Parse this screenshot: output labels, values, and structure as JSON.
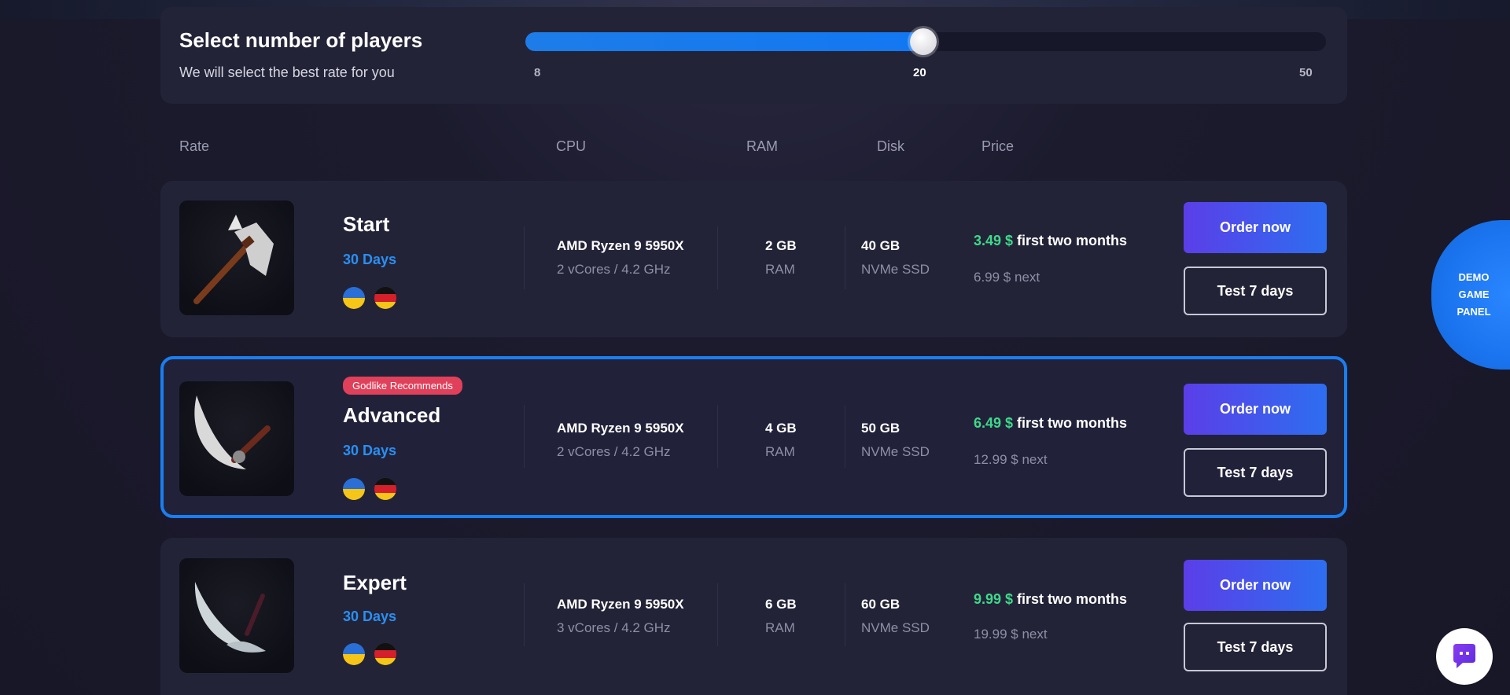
{
  "slider": {
    "title": "Select number of players",
    "subtitle": "We will select the best rate for you",
    "min_label": "8",
    "selected_label": "20",
    "max_label": "50",
    "min": 8,
    "max": 50,
    "value": 20,
    "fill_fraction": 0.497
  },
  "columns": {
    "rate": "Rate",
    "cpu": "CPU",
    "ram": "RAM",
    "disk": "Disk",
    "price": "Price"
  },
  "plans": [
    {
      "name": "Start",
      "period": "30 Days",
      "badge": "",
      "cpu": "AMD Ryzen 9 5950X",
      "cpu_sub": "2 vCores / 4.2 GHz",
      "ram": "2 GB",
      "ram_sub": "RAM",
      "disk": "40 GB",
      "disk_sub": "NVMe SSD",
      "price": "3.49 $",
      "price_suffix": " first two months",
      "next": "6.99 $ next",
      "order_label": "Order now",
      "test_label": "Test 7 days"
    },
    {
      "name": "Advanced",
      "period": "30 Days",
      "badge": "Godlike Recommends",
      "cpu": "AMD Ryzen 9 5950X",
      "cpu_sub": "2 vCores / 4.2 GHz",
      "ram": "4 GB",
      "ram_sub": "RAM",
      "disk": "50 GB",
      "disk_sub": "NVMe SSD",
      "price": "6.49 $",
      "price_suffix": " first two months",
      "next": "12.99 $ next",
      "order_label": "Order now",
      "test_label": "Test 7 days"
    },
    {
      "name": "Expert",
      "period": "30 Days",
      "badge": "",
      "cpu": "AMD Ryzen 9 5950X",
      "cpu_sub": "3 vCores / 4.2 GHz",
      "ram": "6 GB",
      "ram_sub": "RAM",
      "disk": "60 GB",
      "disk_sub": "NVMe SSD",
      "price": "9.99 $",
      "price_suffix": " first two months",
      "next": "19.99 $ next",
      "order_label": "Order now",
      "test_label": "Test 7 days"
    }
  ],
  "demo_tab": {
    "line1": "DEMO",
    "line2": "GAME",
    "line3": "PANEL"
  },
  "icons": {
    "plan_0": "axe-icon",
    "plan_1": "scythe-icon",
    "plan_2": "double-scythe-icon",
    "flag_a": "ukraine-flag-icon",
    "flag_b": "germany-flag-icon",
    "chat": "chat-icon"
  },
  "colors": {
    "accent": "#1a7ef0",
    "price_green": "#3fd98a",
    "badge": "#e0405a",
    "order_start": "#5b3ee8",
    "order_end": "#2d6ef0"
  }
}
